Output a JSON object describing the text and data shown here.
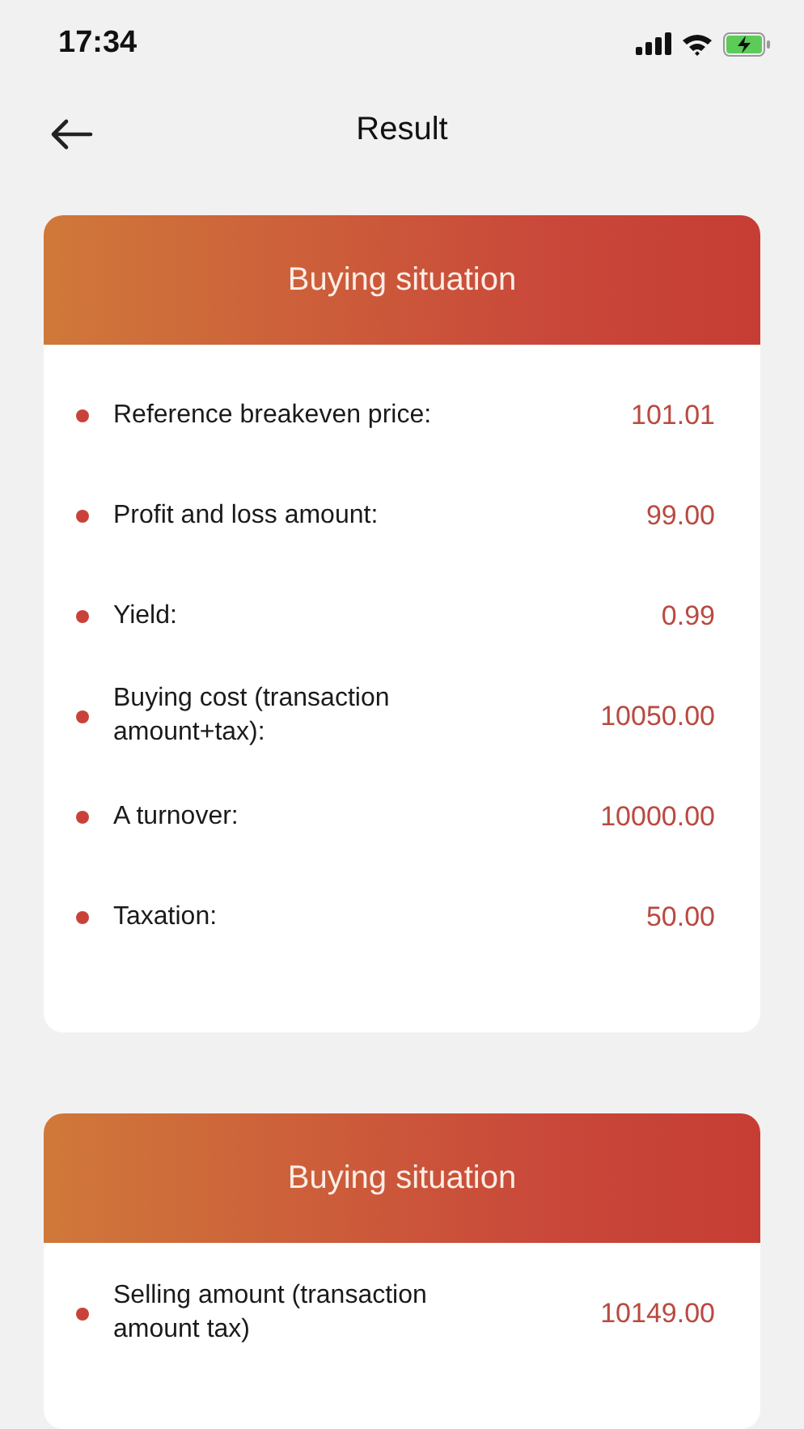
{
  "status_bar": {
    "time": "17:34"
  },
  "nav": {
    "title": "Result"
  },
  "cards": [
    {
      "title": "Buying situation",
      "rows": [
        {
          "label": "Reference breakeven price:",
          "value": "101.01"
        },
        {
          "label": "Profit and loss amount:",
          "value": "99.00"
        },
        {
          "label": "Yield:",
          "value": "0.99"
        },
        {
          "label": "Buying cost (transaction amount+tax):",
          "value": "10050.00"
        },
        {
          "label": "A turnover:",
          "value": "10000.00"
        },
        {
          "label": "Taxation:",
          "value": "50.00"
        }
      ]
    },
    {
      "title": "Buying situation",
      "rows": [
        {
          "label": "Selling amount (transaction amount tax)",
          "value": "10149.00"
        }
      ]
    }
  ]
}
